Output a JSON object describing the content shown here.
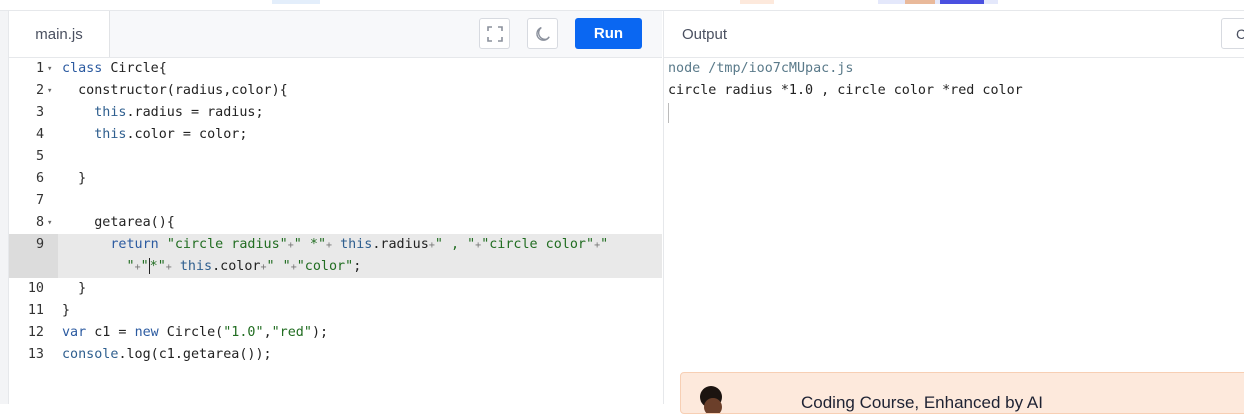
{
  "editor": {
    "file_tab": "main.js",
    "run_label": "Run",
    "lines": [
      {
        "num": "1",
        "fold": "true",
        "parts": [
          [
            "kw",
            "class"
          ],
          [
            "t",
            " Circle{"
          ]
        ]
      },
      {
        "num": "2",
        "fold": "true",
        "parts": [
          [
            "t",
            "  constructor(radius,color){"
          ]
        ]
      },
      {
        "num": "3",
        "fold": "",
        "parts": [
          [
            "t",
            "    "
          ],
          [
            "kw2",
            "this"
          ],
          [
            "t",
            ".radius = radius;"
          ]
        ]
      },
      {
        "num": "4",
        "fold": "",
        "parts": [
          [
            "t",
            "    "
          ],
          [
            "kw2",
            "this"
          ],
          [
            "t",
            ".color = color;"
          ]
        ]
      },
      {
        "num": "5",
        "fold": "",
        "parts": [
          [
            "t",
            ""
          ]
        ]
      },
      {
        "num": "6",
        "fold": "",
        "parts": [
          [
            "t",
            "  }"
          ]
        ]
      },
      {
        "num": "7",
        "fold": "",
        "parts": [
          [
            "t",
            ""
          ]
        ]
      },
      {
        "num": "8",
        "fold": "true",
        "parts": [
          [
            "t",
            "    getarea(){"
          ]
        ]
      },
      {
        "num": "9",
        "fold": "",
        "active": "true",
        "parts": [
          [
            "t",
            "      "
          ],
          [
            "kw",
            "return"
          ],
          [
            "t",
            " "
          ],
          [
            "str",
            "\"circle radius\""
          ],
          [
            "op",
            "+"
          ],
          [
            "str",
            "\" *\""
          ],
          [
            "op",
            "+"
          ],
          [
            "t",
            " "
          ],
          [
            "kw2",
            "this"
          ],
          [
            "t",
            ".radius"
          ],
          [
            "op",
            "+"
          ],
          [
            "str",
            "\" , \""
          ],
          [
            "op",
            "+"
          ],
          [
            "str",
            "\"circle color\""
          ],
          [
            "op",
            "+"
          ],
          [
            "str",
            "\""
          ]
        ]
      },
      {
        "num": "",
        "fold": "",
        "active": "true",
        "cont": "true",
        "parts": [
          [
            "t",
            "        "
          ],
          [
            "str",
            "\""
          ],
          [
            "op",
            "+"
          ],
          [
            "str",
            "\""
          ],
          [
            "cursor",
            ""
          ],
          [
            "str",
            "*\""
          ],
          [
            "op",
            "+"
          ],
          [
            "t",
            " "
          ],
          [
            "kw2",
            "this"
          ],
          [
            "t",
            ".color"
          ],
          [
            "op",
            "+"
          ],
          [
            "str",
            "\" \""
          ],
          [
            "op",
            "+"
          ],
          [
            "str",
            "\"color\""
          ],
          [
            "t",
            ";"
          ]
        ]
      },
      {
        "num": "10",
        "fold": "",
        "parts": [
          [
            "t",
            "  }"
          ]
        ]
      },
      {
        "num": "11",
        "fold": "",
        "parts": [
          [
            "t",
            "}"
          ]
        ]
      },
      {
        "num": "12",
        "fold": "",
        "parts": [
          [
            "kw",
            "var"
          ],
          [
            "t",
            " c1 = "
          ],
          [
            "kw",
            "new"
          ],
          [
            "t",
            " Circle("
          ],
          [
            "str",
            "\"1.0\""
          ],
          [
            "t",
            ","
          ],
          [
            "str",
            "\"red\""
          ],
          [
            "t",
            ");"
          ]
        ]
      },
      {
        "num": "13",
        "fold": "",
        "parts": [
          [
            "kw2",
            "console"
          ],
          [
            "t",
            ".log(c1.getarea());"
          ]
        ]
      }
    ]
  },
  "output": {
    "title": "Output",
    "clear_label": "C",
    "command_line": "node /tmp/ioo7cMUpac.js",
    "result_line": "circle radius *1.0 , circle color *red color"
  },
  "promo": {
    "text": "Coding Course, Enhanced by AI"
  }
}
